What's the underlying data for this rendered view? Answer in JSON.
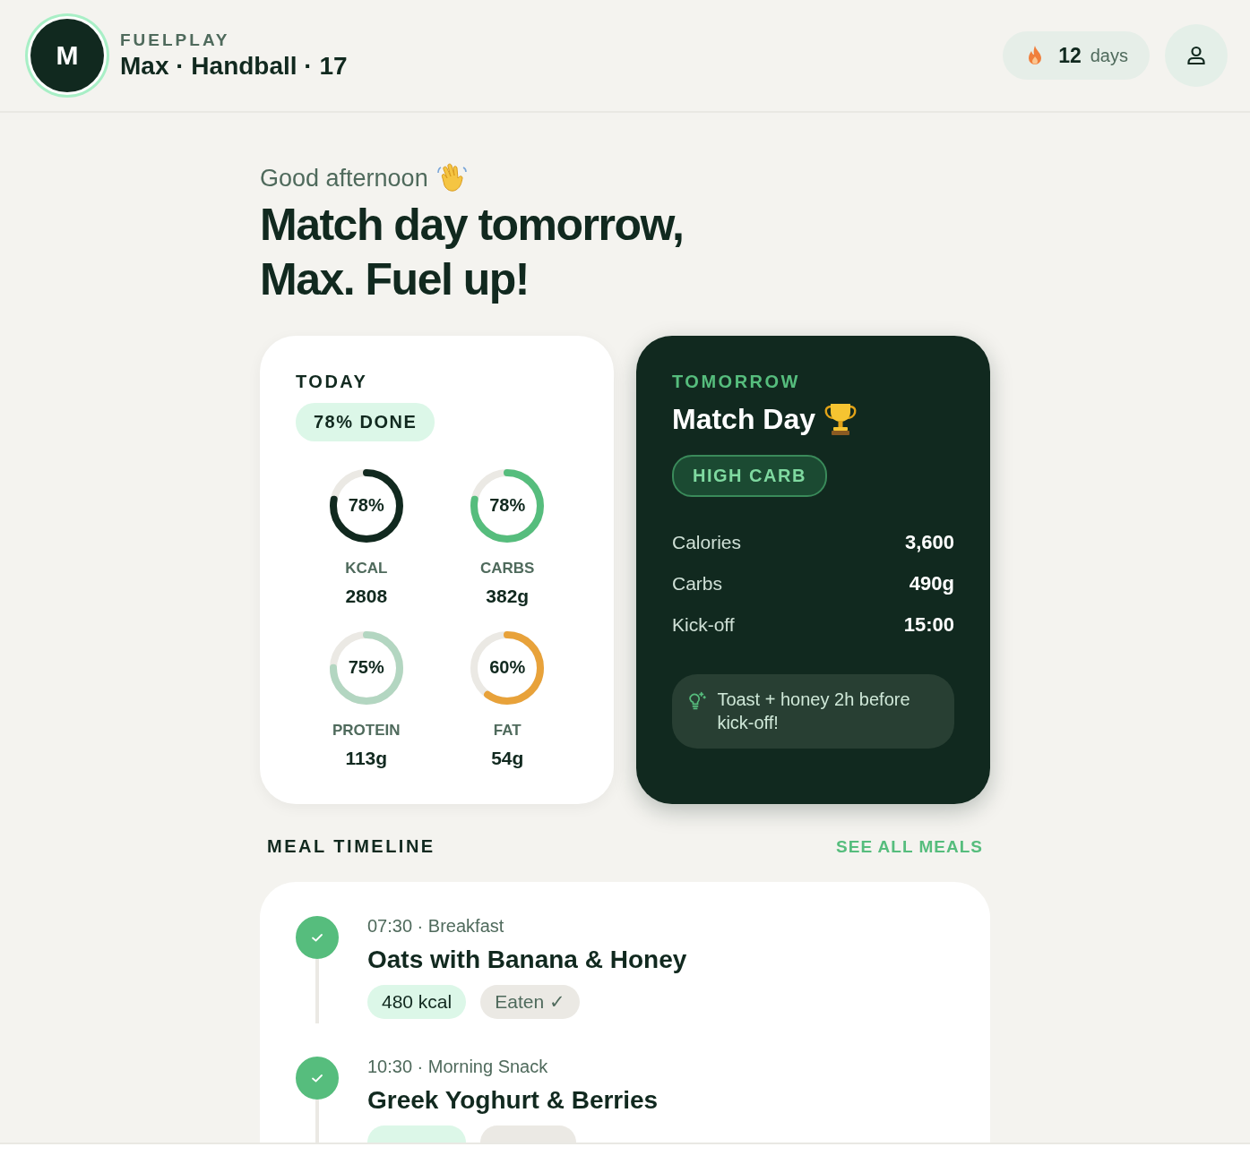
{
  "header": {
    "avatar_initial": "M",
    "brand": "FUELPLAY",
    "profile": "Max · Handball · 17",
    "streak": {
      "count": "12",
      "unit": "days"
    }
  },
  "greeting": "Good afternoon",
  "headline": "Match day tomorrow, Max. Fuel up!",
  "today": {
    "label": "TODAY",
    "badge": "78% DONE",
    "macros": [
      {
        "percent": "78%",
        "name": "KCAL",
        "value": "2808",
        "level": 0.78,
        "color": "#11291f"
      },
      {
        "percent": "78%",
        "name": "CARBS",
        "value": "382g",
        "level": 0.78,
        "color": "#56bd7d"
      },
      {
        "percent": "75%",
        "name": "PROTEIN",
        "value": "113g",
        "level": 0.75,
        "color": "#b3d6c1"
      },
      {
        "percent": "60%",
        "name": "FAT",
        "value": "54g",
        "level": 0.6,
        "color": "#e8a23a"
      }
    ]
  },
  "tomorrow": {
    "label": "TOMORROW",
    "title": "Match Day",
    "tag": "HIGH CARB",
    "stats": [
      {
        "label": "Calories",
        "value": "3,600"
      },
      {
        "label": "Carbs",
        "value": "490g"
      },
      {
        "label": "Kick-off",
        "value": "15:00"
      }
    ],
    "tip": "Toast + honey 2h before kick-off!"
  },
  "timeline": {
    "title": "MEAL TIMELINE",
    "link": "SEE ALL MEALS",
    "meals": [
      {
        "time": "07:30 · Breakfast",
        "name": "Oats with Banana & Honey",
        "kcal": "480 kcal",
        "status": "Eaten ✓",
        "done": true
      },
      {
        "time": "10:30 · Morning Snack",
        "name": "Greek Yoghurt & Berries",
        "done": true
      }
    ]
  }
}
